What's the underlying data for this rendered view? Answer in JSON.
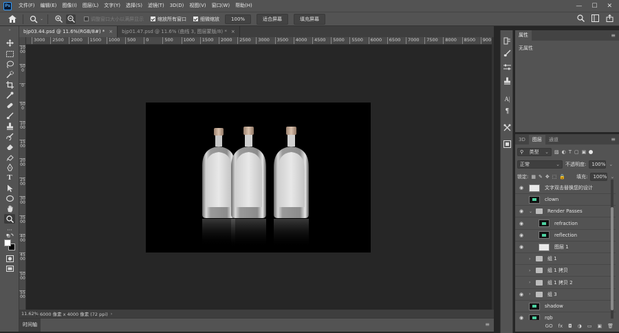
{
  "app": {
    "logo": "Ps"
  },
  "menu": [
    "文件(F)",
    "编辑(E)",
    "图像(I)",
    "图层(L)",
    "文字(Y)",
    "选择(S)",
    "滤镜(T)",
    "3D(D)",
    "视图(V)",
    "窗口(W)",
    "帮助(H)"
  ],
  "window_controls": {
    "minimize": "—",
    "maximize": "☐",
    "close": "✕"
  },
  "options": {
    "resize_windows": "调整窗口大小以满屏显示",
    "zoom_all_windows": "缩放所有窗口",
    "scrubby_zoom": "细微缩放",
    "zoom_value": "100%",
    "fit_screen": "适合屏幕",
    "fill_screen": "填充屏幕"
  },
  "tabs": [
    {
      "label": "bjp03.44.psd @ 11.6%(RGB/8#) *",
      "close": "×"
    },
    {
      "label": "bjp01.47.psd @ 11.6% (曲线 3, 图层蒙版/8) *",
      "close": "×"
    }
  ],
  "ruler": {
    "h_ticks": [
      "3000",
      "2500",
      "2000",
      "1500",
      "1000",
      "500",
      "0",
      "500",
      "1000",
      "1500",
      "2000",
      "2500",
      "3000",
      "3500",
      "4000",
      "4500",
      "5000",
      "5500",
      "6000",
      "6500",
      "7000",
      "7500",
      "8000",
      "8500",
      "900"
    ],
    "v_ticks": [
      "1000",
      "500",
      "0",
      "500",
      "1000",
      "1500",
      "2000",
      "2500",
      "3000",
      "3500",
      "4000",
      "4500",
      "5000",
      "5500"
    ]
  },
  "status": {
    "zoom": "11.62%",
    "doc_info": "6000 像素 x 4000 像素 (72 ppi)"
  },
  "timeline": {
    "label": "时间轴"
  },
  "properties": {
    "title": "属性",
    "empty": "无属性"
  },
  "layers_panel": {
    "tabs": [
      "3D",
      "图层",
      "通道"
    ],
    "filter_kind": "类型",
    "blend_mode": "正常",
    "opacity_label": "不透明度:",
    "opacity_value": "100%",
    "lock_label": "锁定:",
    "fill_label": "填充:",
    "fill_value": "100%",
    "layers": [
      {
        "name": "文字双击替换您的设计",
        "visible": true,
        "kind": "smart"
      },
      {
        "name": "clown",
        "visible": false,
        "kind": "image"
      },
      {
        "name": "Render Passes",
        "visible": true,
        "kind": "group-open"
      },
      {
        "name": "refraction",
        "visible": true,
        "kind": "image"
      },
      {
        "name": "reflection",
        "visible": true,
        "kind": "image"
      },
      {
        "name": "图层 1",
        "visible": true,
        "kind": "white"
      },
      {
        "name": "组 1",
        "visible": false,
        "kind": "group"
      },
      {
        "name": "组 1 拷贝",
        "visible": false,
        "kind": "group"
      },
      {
        "name": "组 1 拷贝 2",
        "visible": false,
        "kind": "group"
      },
      {
        "name": "组 3",
        "visible": true,
        "kind": "group"
      },
      {
        "name": "shadow",
        "visible": false,
        "kind": "image"
      },
      {
        "name": "rgb",
        "visible": true,
        "kind": "image"
      }
    ],
    "footer": [
      "GO",
      "fx",
      "◘",
      "◑",
      "▭",
      "▣",
      "🗑"
    ]
  },
  "colors": {
    "chrome": "#535353",
    "workspace": "#262626",
    "panel_dark": "#434343"
  }
}
